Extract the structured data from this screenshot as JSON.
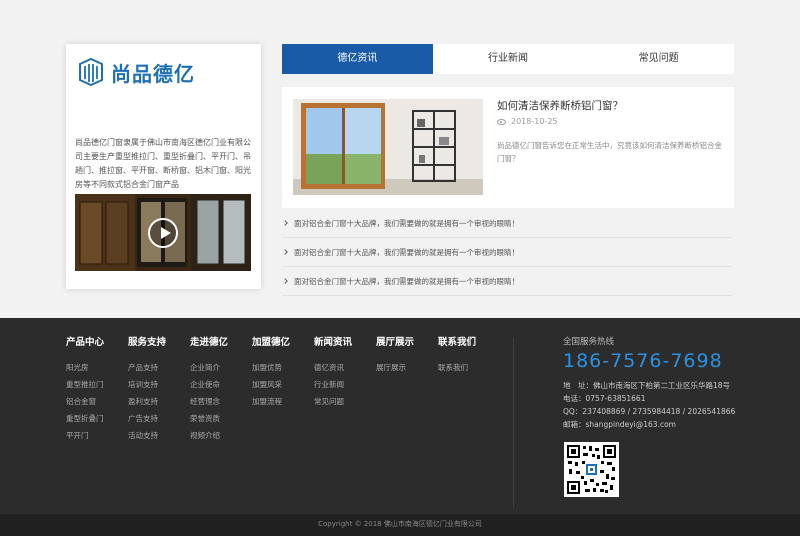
{
  "about": {
    "logo_text": "尚品德亿",
    "logo_icon": "window-logo-icon",
    "description": "尚品德亿门窗隶属于佛山市南海区德亿门业有限公司主要生产重型推拉门、重型折叠门、平开门、吊趟门、推拉窗、平开窗、断桥窗、铝木门窗、阳光房等不同款式铝合金门窗产品",
    "arrow": "→",
    "video_icon": "play-icon"
  },
  "tabs": [
    {
      "label": "德亿资讯",
      "active": true
    },
    {
      "label": "行业新闻",
      "active": false
    },
    {
      "label": "常见问题",
      "active": false
    }
  ],
  "featured": {
    "title": "如何清洁保养断桥铝门窗？",
    "date": "2018-10-25",
    "description": "尚品德亿门窗告诉您在正常生活中，究竟该如何清洁保养断桥铝合金门窗？"
  },
  "news": [
    "面对铝合金门窗十大品牌，我们需要做的就是拥有一个审视的眼睛！",
    "面对铝合金门窗十大品牌，我们需要做的就是拥有一个审视的眼睛！",
    "面对铝合金门窗十大品牌，我们需要做的就是拥有一个审视的眼睛！"
  ],
  "footer": {
    "columns": [
      {
        "title": "产品中心",
        "links": [
          "阳光房",
          "重型推拉门",
          "铝合金窗",
          "重型折叠门",
          "平开门"
        ]
      },
      {
        "title": "服务支持",
        "links": [
          "产品支持",
          "培训支持",
          "盈利支持",
          "广告支持",
          "活动支持"
        ]
      },
      {
        "title": "走进德亿",
        "links": [
          "企业简介",
          "企业使命",
          "经营理念",
          "荣誉资质",
          "视频介绍"
        ]
      },
      {
        "title": "加盟德亿",
        "links": [
          "加盟优势",
          "加盟风采",
          "加盟流程"
        ]
      },
      {
        "title": "新闻资讯",
        "links": [
          "德亿资讯",
          "行业新闻",
          "常见问题"
        ]
      },
      {
        "title": "展厅展示",
        "links": [
          "展厅展示"
        ]
      },
      {
        "title": "联系我们",
        "links": [
          "联系我们"
        ]
      }
    ],
    "hotline_label": "全国服务热线",
    "hotline_number": "186-7576-7698",
    "contact_lines": [
      "地　址：佛山市南海区下柏第二工业区乐华路18号",
      "电话：0757-63851661",
      "QQ：237408869 / 2735984418 / 2026541866",
      "邮箱：shangpindeyi@163.com"
    ],
    "qr_icon": "qr-code-icon",
    "copyright": "Copyright © 2018 佛山市南海区德亿门业有限公司"
  }
}
